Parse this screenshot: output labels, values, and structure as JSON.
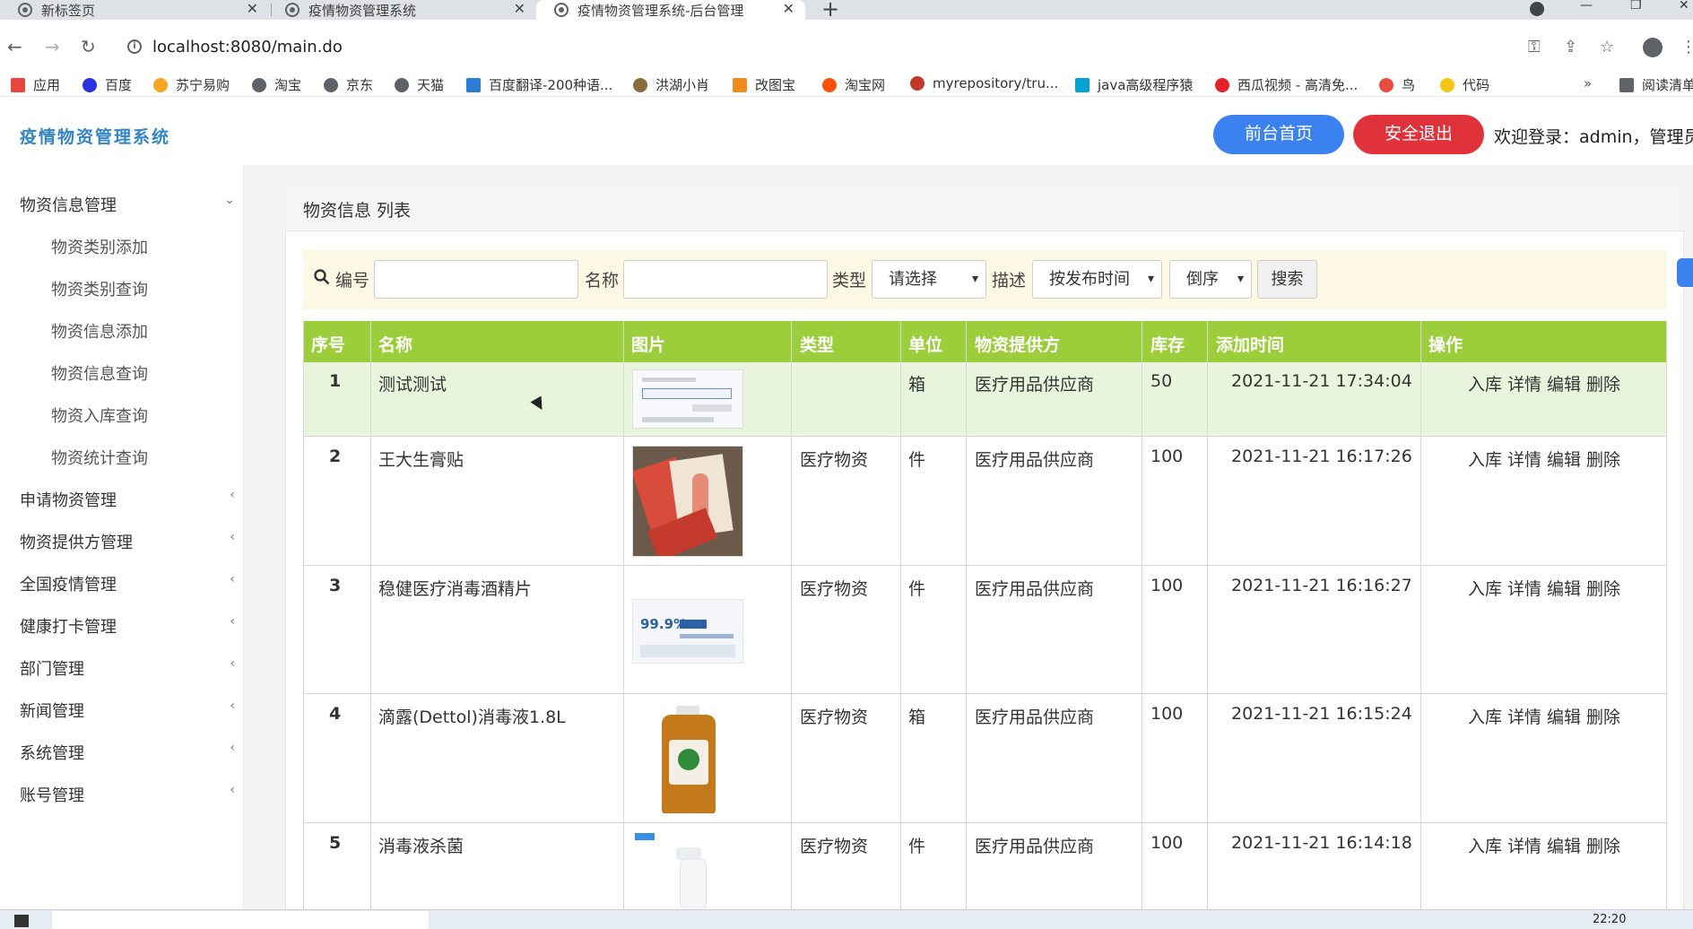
{
  "browser": {
    "tabs": [
      {
        "title": "新标签页",
        "active": false
      },
      {
        "title": "疫情物资管理系统",
        "active": false
      },
      {
        "title": "疫情物资管理系统-后台管理",
        "active": true
      }
    ],
    "url": "localhost:8080/main.do",
    "bookmarks": [
      {
        "label": "应用",
        "color": "#e8453c"
      },
      {
        "label": "百度",
        "color": "#2932e1"
      },
      {
        "label": "苏宁易购",
        "color": "#f5a623"
      },
      {
        "label": "淘宝",
        "color": "#5f6368"
      },
      {
        "label": "京东",
        "color": "#5f6368"
      },
      {
        "label": "天猫",
        "color": "#5f6368"
      },
      {
        "label": "百度翻译-200种语...",
        "color": "#2b7cd3"
      },
      {
        "label": "洪湖小肖",
        "color": "#8a6d3b"
      },
      {
        "label": "改图宝",
        "color": "#f08a1c"
      },
      {
        "label": "淘宝网",
        "color": "#ff5000"
      },
      {
        "label": "myrepository/tru...",
        "color": "#c0392b"
      },
      {
        "label": "java高级程序猿",
        "color": "#00a1d6"
      },
      {
        "label": "西瓜视频 - 高清免...",
        "color": "#e6212a"
      },
      {
        "label": "鸟",
        "color": "#e74c3c"
      },
      {
        "label": "代码",
        "color": "#f5c518"
      },
      {
        "label": "阅读清单",
        "color": "#5f6368"
      }
    ]
  },
  "header": {
    "brand": "疫情物资管理系统",
    "home_button": "前台首页",
    "logout_button": "安全退出",
    "welcome": "欢迎登录：admin，管理员"
  },
  "sidebar": {
    "menus": [
      {
        "label": "物资信息管理",
        "expanded": true,
        "children": [
          "物资类别添加",
          "物资类别查询",
          "物资信息添加",
          "物资信息查询",
          "物资入库查询",
          "物资统计查询"
        ]
      },
      {
        "label": "申请物资管理"
      },
      {
        "label": "物资提供方管理"
      },
      {
        "label": "全国疫情管理"
      },
      {
        "label": "健康打卡管理"
      },
      {
        "label": "部门管理"
      },
      {
        "label": "新闻管理"
      },
      {
        "label": "系统管理"
      },
      {
        "label": "账号管理"
      }
    ]
  },
  "panel": {
    "title": "物资信息 列表"
  },
  "search": {
    "code_label": "编号",
    "code_value": "",
    "name_label": "名称",
    "name_value": "",
    "type_label": "类型",
    "type_selected": "请选择",
    "desc_label": "描述",
    "sort_by_selected": "按发布时间",
    "order_selected": "倒序",
    "search_button": "搜索"
  },
  "table": {
    "columns": [
      "序号",
      "名称",
      "图片",
      "类型",
      "单位",
      "物资提供方",
      "库存",
      "添加时间",
      "操作"
    ],
    "actions": [
      "入库",
      "详情",
      "编辑",
      "删除"
    ],
    "rows": [
      {
        "no": "1",
        "name": "测试测试",
        "type": "",
        "unit": "箱",
        "supplier": "医疗用品供应商",
        "stock": "50",
        "added": "2021-11-21 17:34:04",
        "image": "screenshot-thumbnail"
      },
      {
        "no": "2",
        "name": "王大生膏贴",
        "type": "医疗物资",
        "unit": "件",
        "supplier": "医疗用品供应商",
        "stock": "100",
        "added": "2021-11-21 16:17:26",
        "image": "plaster-packs"
      },
      {
        "no": "3",
        "name": "稳健医疗消毒酒精片",
        "type": "医疗物资",
        "unit": "件",
        "supplier": "医疗用品供应商",
        "stock": "100",
        "added": "2021-11-21 16:16:27",
        "image": "alcohol-pads"
      },
      {
        "no": "4",
        "name": "滴露(Dettol)消毒液1.8L",
        "type": "医疗物资",
        "unit": "箱",
        "supplier": "医疗用品供应商",
        "stock": "100",
        "added": "2021-11-21 16:15:24",
        "image": "dettol-bottle"
      },
      {
        "no": "5",
        "name": "消毒液杀菌",
        "type": "医疗物资",
        "unit": "件",
        "supplier": "医疗用品供应商",
        "stock": "100",
        "added": "2021-11-21 16:14:18",
        "image": "spray-bottle"
      }
    ]
  },
  "taskbar": {
    "clock": "22:20"
  },
  "colors": {
    "table_header": "#9bce3a",
    "row_highlight": "#e9f4dc",
    "home_button": "#3b82f0",
    "logout_button": "#e0323a",
    "search_bar": "#fcf8e3",
    "brand": "#3385c6"
  }
}
